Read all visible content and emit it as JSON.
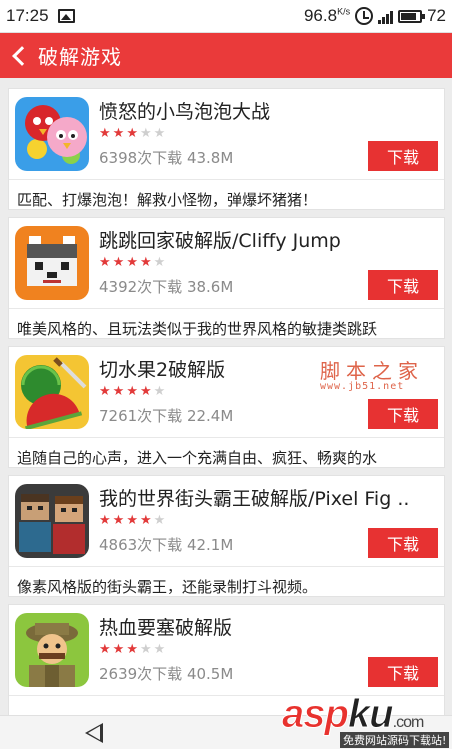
{
  "status_bar": {
    "time": "17:25",
    "battery_percent": "96.8",
    "battery_unit": "K/s",
    "signal_label": "72",
    "icons": [
      "image-icon",
      "alarm-icon",
      "signal-icon",
      "battery-icon"
    ]
  },
  "header": {
    "title": "破解游戏",
    "back_icon": "chevron-left-icon",
    "bg_color": "#ea3a3a"
  },
  "apps": [
    {
      "name": "愤怒的小鸟泡泡大战",
      "rating": 3,
      "max_rating": 5,
      "meta": "6398次下载 43.8M",
      "download_label": "下载",
      "description": "匹配、打爆泡泡！解救小怪物，弹爆坏猪猪！",
      "icon": "angry-birds-icon"
    },
    {
      "name": "跳跳回家破解版/Cliffy Jump",
      "rating": 4,
      "max_rating": 5,
      "meta": "4392次下载 38.6M",
      "download_label": "下载",
      "description": "唯美风格的、且玩法类似于我的世界风格的敏捷类跳跃",
      "icon": "husky-icon"
    },
    {
      "name": "切水果2破解版",
      "rating": 4,
      "max_rating": 5,
      "meta": "7261次下载 22.4M",
      "download_label": "下载",
      "description": "追随自己的心声，进入一个充满自由、疯狂、畅爽的水",
      "icon": "watermelon-icon"
    },
    {
      "name": "我的世界街头霸王破解版/Pixel Fig ..",
      "rating": 4,
      "max_rating": 5,
      "meta": "4863次下载 42.1M",
      "download_label": "下载",
      "description": "像素风格版的街头霸王，还能录制打斗视频。",
      "icon": "pixel-fighter-icon"
    },
    {
      "name": "热血要塞破解版",
      "rating": 3,
      "max_rating": 5,
      "meta": "2639次下载 40.5M",
      "download_label": "下载",
      "description": "",
      "icon": "soldier-icon"
    }
  ],
  "watermarks": {
    "jb51": "脚本之家",
    "jb51_url": "www.jb51.net",
    "aspku_red": "asp",
    "aspku_dark": "ku",
    "aspku_suffix": ".com",
    "aspku_sub": "免费网站源码下载站!"
  },
  "nav_bar": {
    "back_icon": "triangle-back-icon"
  }
}
